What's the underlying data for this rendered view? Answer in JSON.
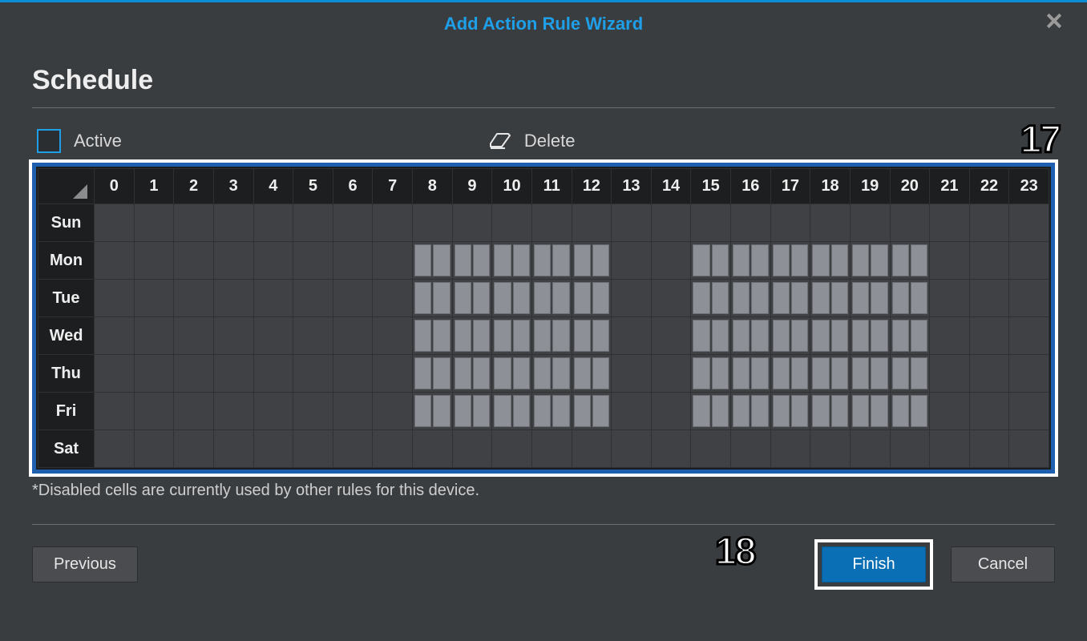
{
  "dialog": {
    "title": "Add Action Rule Wizard"
  },
  "page": {
    "heading": "Schedule"
  },
  "tools": {
    "active": "Active",
    "delete": "Delete"
  },
  "annotations": {
    "step17": "17",
    "step18": "18"
  },
  "grid": {
    "hours": [
      "0",
      "1",
      "2",
      "3",
      "4",
      "5",
      "6",
      "7",
      "8",
      "9",
      "10",
      "11",
      "12",
      "13",
      "14",
      "15",
      "16",
      "17",
      "18",
      "19",
      "20",
      "21",
      "22",
      "23"
    ],
    "days": [
      "Sun",
      "Mon",
      "Tue",
      "Wed",
      "Thu",
      "Fri",
      "Sat"
    ],
    "cells": {
      "Sun": [
        0,
        0,
        0,
        0,
        0,
        0,
        0,
        0,
        0,
        0,
        0,
        0,
        0,
        0,
        0,
        0,
        0,
        0,
        0,
        0,
        0,
        0,
        0,
        0
      ],
      "Mon": [
        0,
        0,
        0,
        0,
        0,
        0,
        0,
        0,
        1,
        1,
        1,
        1,
        1,
        0,
        0,
        1,
        1,
        1,
        1,
        1,
        1,
        0,
        0,
        0
      ],
      "Tue": [
        0,
        0,
        0,
        0,
        0,
        0,
        0,
        0,
        1,
        1,
        1,
        1,
        1,
        0,
        0,
        1,
        1,
        1,
        1,
        1,
        1,
        0,
        0,
        0
      ],
      "Wed": [
        0,
        0,
        0,
        0,
        0,
        0,
        0,
        0,
        1,
        1,
        1,
        1,
        1,
        0,
        0,
        1,
        1,
        1,
        1,
        1,
        1,
        0,
        0,
        0
      ],
      "Thu": [
        0,
        0,
        0,
        0,
        0,
        0,
        0,
        0,
        1,
        1,
        1,
        1,
        1,
        0,
        0,
        1,
        1,
        1,
        1,
        1,
        1,
        0,
        0,
        0
      ],
      "Fri": [
        0,
        0,
        0,
        0,
        0,
        0,
        0,
        0,
        1,
        1,
        1,
        1,
        1,
        0,
        0,
        1,
        1,
        1,
        1,
        1,
        1,
        0,
        0,
        0
      ],
      "Sat": [
        0,
        0,
        0,
        0,
        0,
        0,
        0,
        0,
        0,
        0,
        0,
        0,
        0,
        0,
        0,
        0,
        0,
        0,
        0,
        0,
        0,
        0,
        0,
        0
      ]
    }
  },
  "note": "*Disabled cells are currently used by other rules for this device.",
  "buttons": {
    "previous": "Previous",
    "finish": "Finish",
    "cancel": "Cancel"
  }
}
